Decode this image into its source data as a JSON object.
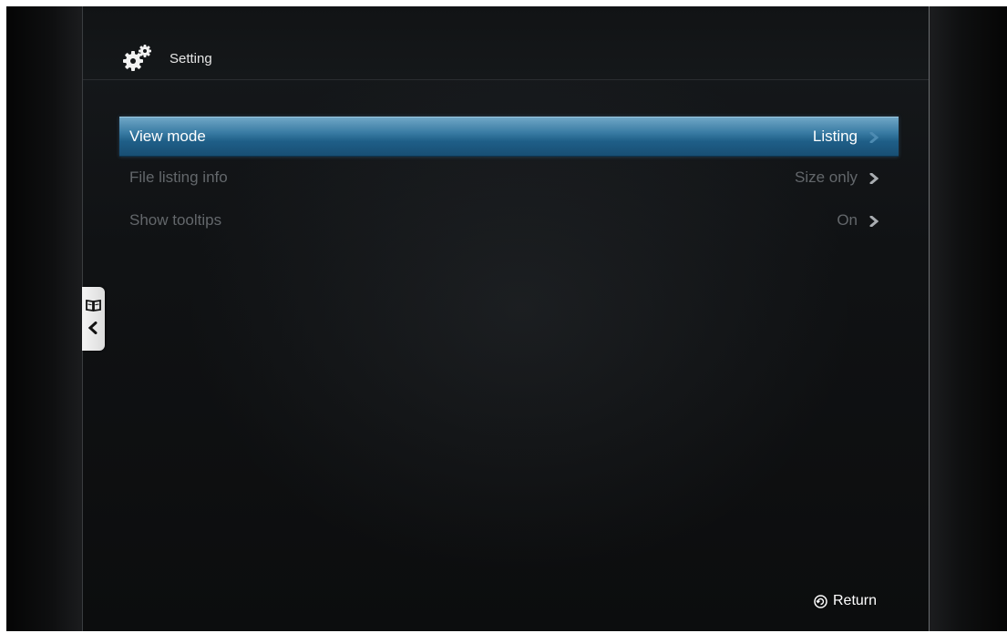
{
  "header": {
    "title": "Setting",
    "icon": "gear-icon"
  },
  "menu": {
    "items": [
      {
        "label": "View mode",
        "value": "Listing",
        "selected": true
      },
      {
        "label": "File listing info",
        "value": "Size only",
        "selected": false
      },
      {
        "label": "Show tooltips",
        "value": "On",
        "selected": false
      }
    ]
  },
  "side_tab": {
    "icons": [
      "book-icon",
      "chevron-left-icon"
    ]
  },
  "footer": {
    "return_label": "Return",
    "return_icon": "return-button-icon"
  },
  "colors": {
    "selection": "#2a6f9c",
    "text_inactive": "#63676b",
    "text_active": "#ffffff",
    "background": "#0c0d0e"
  }
}
